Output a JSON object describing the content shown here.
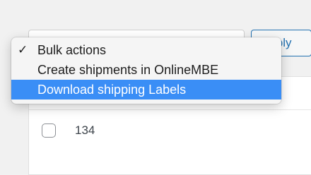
{
  "bulk_select": {
    "apply_label": "Apply",
    "options": [
      {
        "label": "Bulk actions",
        "checked": true
      },
      {
        "label": "Create shipments in OnlineMBE",
        "checked": false
      },
      {
        "label": "Download shipping Labels",
        "checked": false,
        "highlighted": true
      }
    ],
    "check_glyph": "✓"
  },
  "table": {
    "rows": [
      {
        "id": "134"
      }
    ]
  },
  "colors": {
    "highlight": "#3a8ef6",
    "apply_border": "#2271b1"
  }
}
